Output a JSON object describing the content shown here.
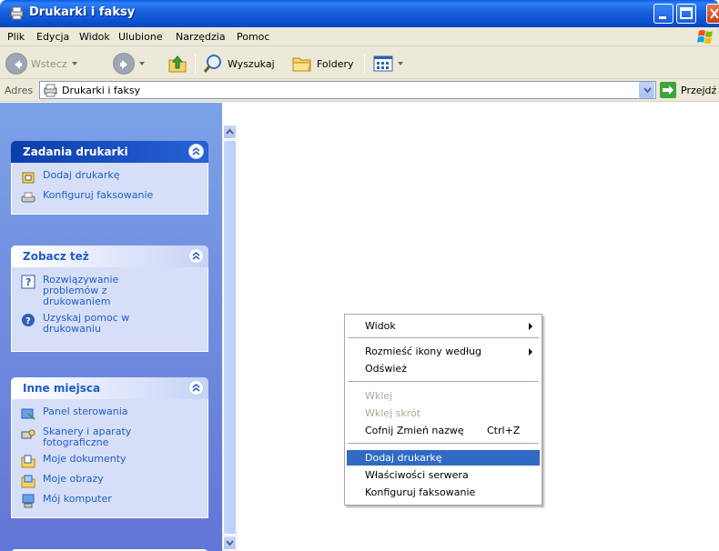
{
  "window": {
    "title": "Drukarki i faksy"
  },
  "menubar": {
    "items": [
      "Plik",
      "Edycja",
      "Widok",
      "Ulubione",
      "Narzędzia",
      "Pomoc"
    ]
  },
  "toolbar": {
    "back_label": "Wstecz",
    "search_label": "Wyszukaj",
    "folders_label": "Foldery"
  },
  "address": {
    "label": "Adres",
    "value": "Drukarki i faksy",
    "go_label": "Przejdź"
  },
  "sidebar": {
    "panels": [
      {
        "title": "Zadania drukarki",
        "items": [
          "Dodaj drukarkę",
          "Konfiguruj faksowanie"
        ]
      },
      {
        "title": "Zobacz też",
        "items": [
          "Rozwiązywanie problemów z drukowaniem",
          "Uzyskaj pomoc w drukowaniu"
        ]
      },
      {
        "title": "Inne miejsca",
        "items": [
          "Panel sterowania",
          "Skanery i aparaty fotograficzne",
          "Moje dokumenty",
          "Moje obrazy",
          "Mój komputer"
        ]
      }
    ]
  },
  "context_menu": {
    "items": [
      {
        "label": "Widok",
        "submenu": true
      },
      {
        "label": "Rozmieść ikony według",
        "submenu": true
      },
      {
        "label": "Odśwież"
      },
      {
        "label": "Wklej",
        "disabled": true
      },
      {
        "label": "Wklej skrót",
        "disabled": true
      },
      {
        "label": "Cofnij Zmień nazwę",
        "shortcut": "Ctrl+Z"
      },
      {
        "label": "Dodaj drukarkę",
        "highlighted": true
      },
      {
        "label": "Właściwości serwera"
      },
      {
        "label": "Konfiguruj faksowanie"
      }
    ]
  }
}
